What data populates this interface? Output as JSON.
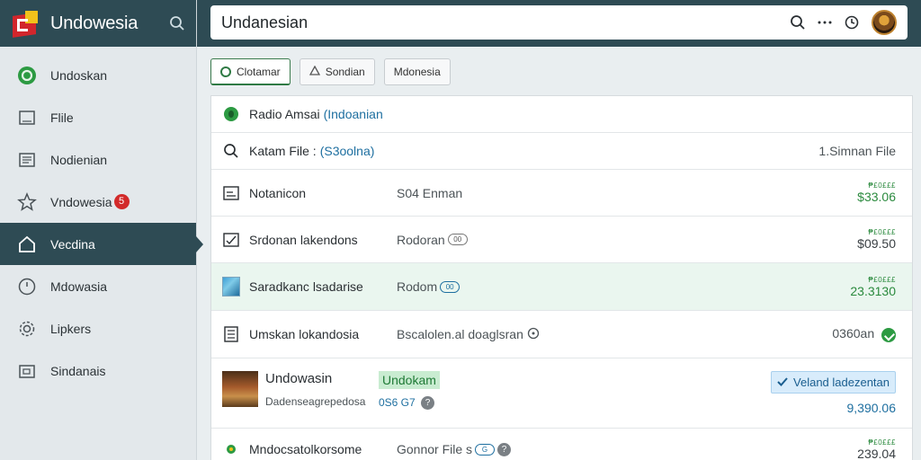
{
  "app": {
    "name": "Undowesia"
  },
  "search": {
    "value": "Undanesian"
  },
  "sidebar": {
    "items": [
      {
        "label": "Undoskan",
        "icon": "circle-logo-icon"
      },
      {
        "label": "Flile",
        "icon": "file-icon"
      },
      {
        "label": "Nodienian",
        "icon": "document-icon"
      },
      {
        "label": "Vndowesia",
        "icon": "star-icon",
        "badge": "5"
      },
      {
        "label": "Vecdina",
        "icon": "home-icon",
        "active": true
      },
      {
        "label": "Mdowasia",
        "icon": "clock-icon"
      },
      {
        "label": "Lipkers",
        "icon": "gear-icon"
      },
      {
        "label": "Sindanais",
        "icon": "folder-icon"
      }
    ]
  },
  "toolbar": {
    "buttons": [
      {
        "label": "Clotamar"
      },
      {
        "label": "Sondian"
      },
      {
        "label": "Mdonesia"
      }
    ]
  },
  "list": {
    "header": {
      "title": "Radio Amsai",
      "link": "(Indoanian"
    },
    "search_row": {
      "label": "Katam File :",
      "link": "(S3oolna)",
      "right": "1.Simnan File"
    },
    "rows": [
      {
        "title": "Notanicon",
        "meta": "S04 Enman",
        "price_small": "₱£0£££",
        "price": "$33.06"
      },
      {
        "title": "Srdonan lakendons",
        "meta": "Rodoran",
        "tag": "00",
        "price_small": "₱£0£££",
        "price": "$09.50"
      },
      {
        "title": "Saradkanc lsadarise",
        "meta": "Rodom",
        "tag": "00",
        "price_small": "₱£0£££",
        "price": "23.3130"
      },
      {
        "title": "Umskan lokandosia",
        "meta": "Bscalolen.al doaglsran",
        "right": "0360an"
      },
      {
        "title": "Undowasin",
        "subtitle": "Dadenseagrepedosa",
        "pill": "Undokam",
        "meta": "0S6 G7",
        "action": "Veland ladezentan",
        "price": "9,390.06"
      },
      {
        "title": "Mndocsatolkorsome",
        "meta": "Gonnor File s",
        "tag": "G",
        "price_small": "₱£0£££",
        "price": "239.04"
      }
    ]
  }
}
